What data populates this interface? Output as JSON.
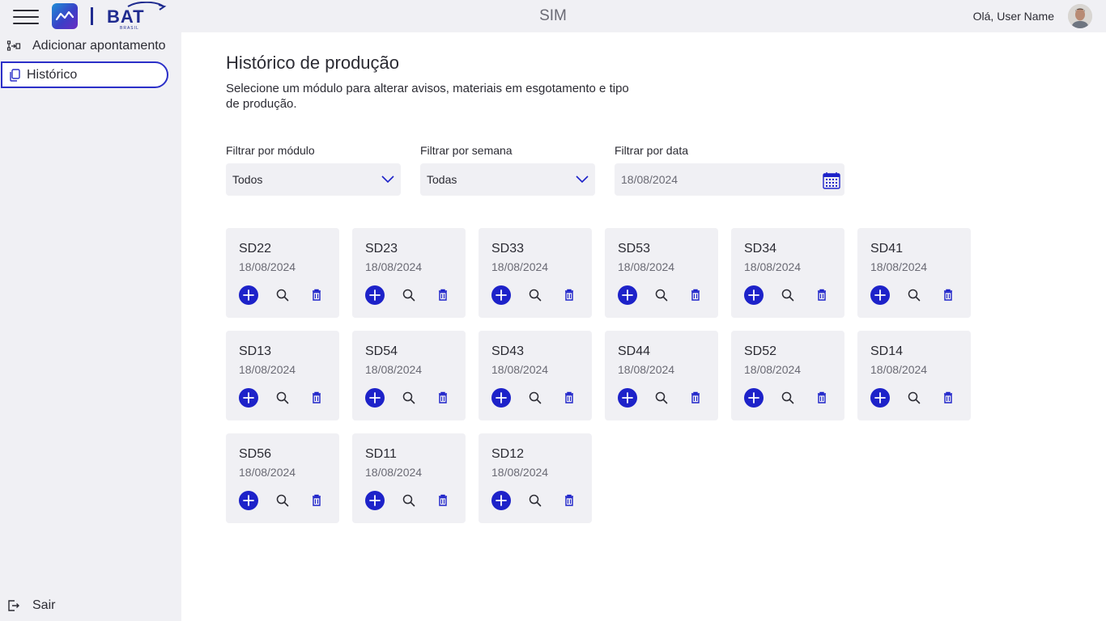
{
  "header": {
    "title": "SIM",
    "greeting": "Olá, User Name",
    "brand_name": "BAT",
    "brand_sub": "BRASIL"
  },
  "sidebar": {
    "items": [
      {
        "label": "Adicionar apontamento",
        "icon": "add-entry-icon"
      },
      {
        "label": "Histórico",
        "icon": "copy-icon",
        "active": true
      }
    ],
    "logout": {
      "label": "Sair",
      "icon": "logout-icon"
    }
  },
  "main": {
    "title": "Histórico de produção",
    "description": "Selecione um módulo para alterar avisos, materiais em esgotamento e tipo de produção.",
    "filters": {
      "module": {
        "label": "Filtrar por módulo",
        "value": "Todos"
      },
      "week": {
        "label": "Filtrar por semana",
        "value": "Todas"
      },
      "date": {
        "label": "Filtrar por data",
        "value": "18/08/2024"
      }
    },
    "cards": [
      {
        "name": "SD22",
        "date": "18/08/2024"
      },
      {
        "name": "SD23",
        "date": "18/08/2024"
      },
      {
        "name": "SD33",
        "date": "18/08/2024"
      },
      {
        "name": "SD53",
        "date": "18/08/2024"
      },
      {
        "name": "SD34",
        "date": "18/08/2024"
      },
      {
        "name": "SD41",
        "date": "18/08/2024"
      },
      {
        "name": "SD13",
        "date": "18/08/2024"
      },
      {
        "name": "SD54",
        "date": "18/08/2024"
      },
      {
        "name": "SD43",
        "date": "18/08/2024"
      },
      {
        "name": "SD44",
        "date": "18/08/2024"
      },
      {
        "name": "SD52",
        "date": "18/08/2024"
      },
      {
        "name": "SD14",
        "date": "18/08/2024"
      },
      {
        "name": "SD56",
        "date": "18/08/2024"
      },
      {
        "name": "SD11",
        "date": "18/08/2024"
      },
      {
        "name": "SD12",
        "date": "18/08/2024"
      }
    ]
  },
  "colors": {
    "accent": "#1d22c9",
    "panel": "#f0f0f4",
    "text": "#2b2b33",
    "muted": "#6a6a74"
  }
}
